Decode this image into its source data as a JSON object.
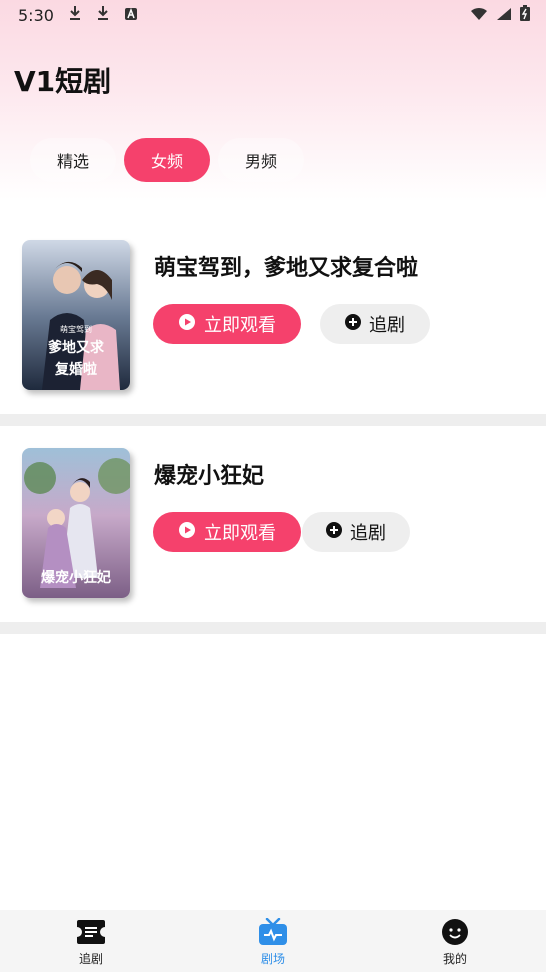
{
  "status_bar": {
    "time": "5:30"
  },
  "app": {
    "title": "V1短剧"
  },
  "tabs": [
    {
      "label": "精选",
      "active": false
    },
    {
      "label": "女频",
      "active": true
    },
    {
      "label": "男频",
      "active": false
    }
  ],
  "dramas": [
    {
      "title": "萌宝驾到，爹地又求复合啦",
      "watch_label": "立即观看",
      "follow_label": "追剧",
      "cover_text": "萌宝驾到 爹地又求复婚啦"
    },
    {
      "title": "爆宠小狂妃",
      "watch_label": "立即观看",
      "follow_label": "追剧",
      "cover_text": "爆宠小狂妃"
    }
  ],
  "bottom_nav": [
    {
      "label": "追剧",
      "icon": "ticket-icon",
      "active": false
    },
    {
      "label": "剧场",
      "icon": "tv-icon",
      "active": true
    },
    {
      "label": "我的",
      "icon": "profile-face-icon",
      "active": false
    }
  ],
  "colors": {
    "accent": "#f5416c",
    "nav_active": "#2f8fe8"
  }
}
